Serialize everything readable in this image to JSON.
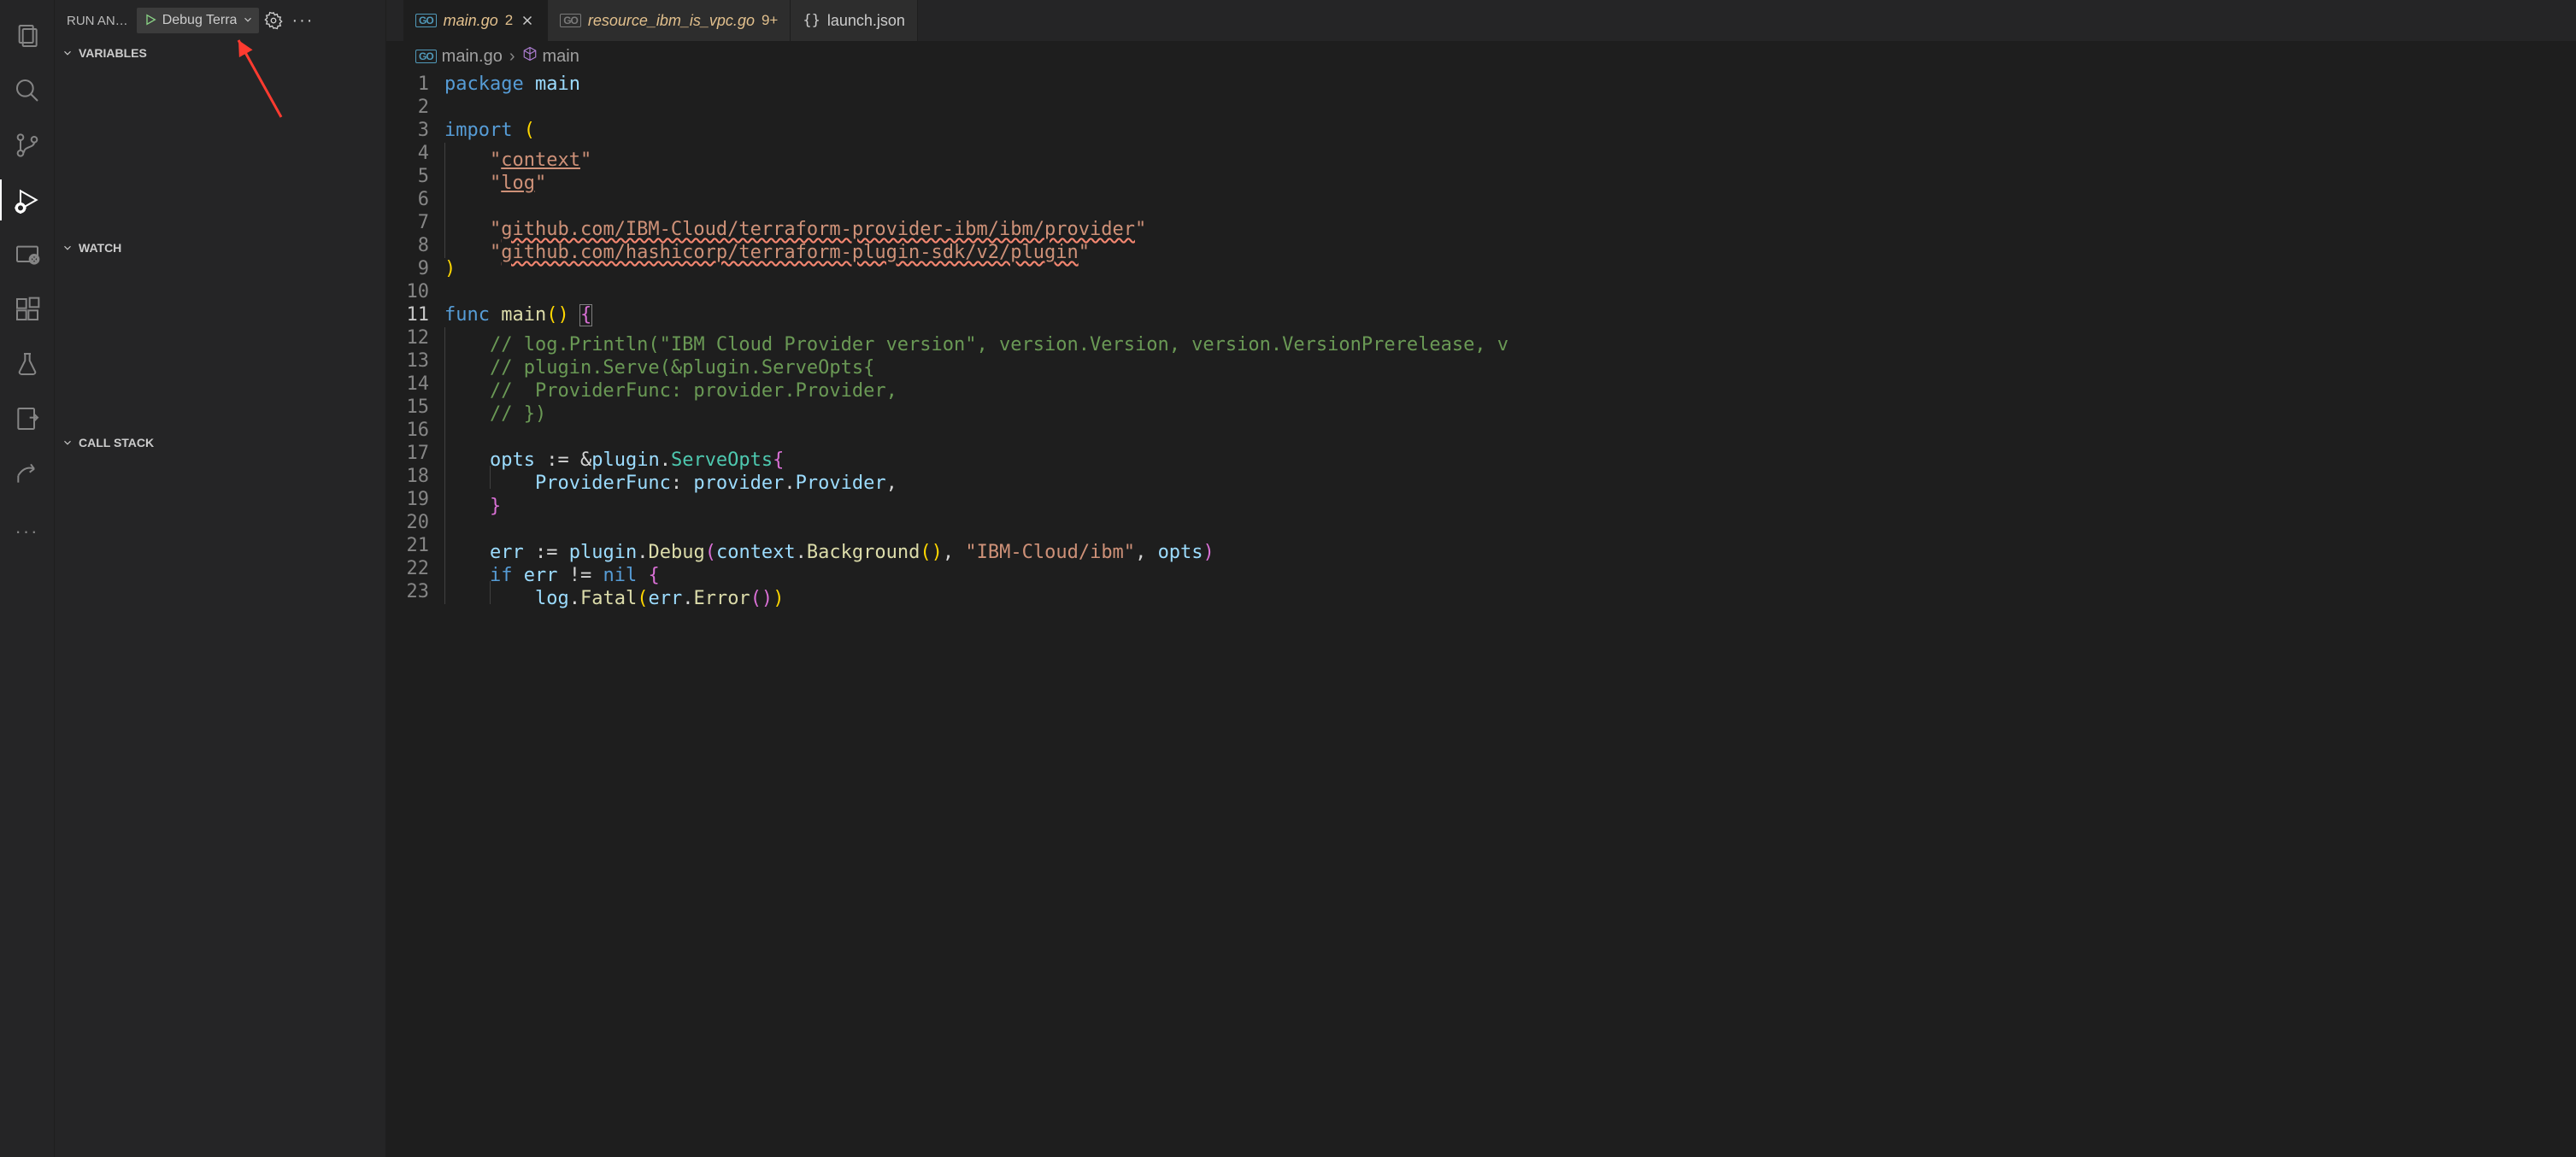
{
  "activity": {
    "items": [
      "explorer",
      "search",
      "source-control",
      "run-debug",
      "remote",
      "extensions",
      "testing",
      "references"
    ],
    "active": "run-debug"
  },
  "sidebar": {
    "title": "RUN AN…",
    "start_button": "▶",
    "config_name": "Debug Terra",
    "sections": {
      "variables": "VARIABLES",
      "watch": "WATCH",
      "callstack": "CALL STACK"
    }
  },
  "tabs": [
    {
      "icon": "go",
      "label": "main.go",
      "problems": "2",
      "active": true,
      "close": true,
      "modified": true
    },
    {
      "icon": "go",
      "label": "resource_ibm_is_vpc.go",
      "problems": "9+",
      "active": false,
      "close": false,
      "modified": true
    },
    {
      "icon": "json",
      "label": "launch.json",
      "problems": "",
      "active": false,
      "close": false,
      "modified": false
    }
  ],
  "breadcrumb": {
    "file_icon": "go",
    "file": "main.go",
    "symbol_icon": "module",
    "symbol": "main"
  },
  "code": {
    "lines": [
      {
        "n": 1,
        "tokens": [
          [
            "kw",
            "package "
          ],
          [
            "pkg",
            "main"
          ]
        ]
      },
      {
        "n": 2,
        "tokens": []
      },
      {
        "n": 3,
        "tokens": [
          [
            "kw",
            "import "
          ],
          [
            "paren",
            "("
          ]
        ]
      },
      {
        "n": 4,
        "tokens": [
          [
            "guide",
            ""
          ],
          [
            "plain",
            "    "
          ],
          [
            "str",
            "\""
          ],
          [
            "str-u",
            "context"
          ],
          [
            "str",
            "\""
          ]
        ]
      },
      {
        "n": 5,
        "tokens": [
          [
            "guide",
            ""
          ],
          [
            "plain",
            "    "
          ],
          [
            "str",
            "\""
          ],
          [
            "str-u",
            "log"
          ],
          [
            "str",
            "\""
          ]
        ]
      },
      {
        "n": 6,
        "tokens": [
          [
            "guide",
            ""
          ]
        ]
      },
      {
        "n": 7,
        "tokens": [
          [
            "guide",
            ""
          ],
          [
            "plain",
            "    "
          ],
          [
            "str",
            "\""
          ],
          [
            "str-err",
            "github.com/IBM-Cloud/terraform-provider-ibm/ibm/provider"
          ],
          [
            "str",
            "\""
          ]
        ]
      },
      {
        "n": 8,
        "tokens": [
          [
            "guide",
            ""
          ],
          [
            "plain",
            "    "
          ],
          [
            "str",
            "\""
          ],
          [
            "str-err",
            "github.com/hashicorp/terraform-plugin-sdk/v2/plugin"
          ],
          [
            "str",
            "\""
          ]
        ]
      },
      {
        "n": 9,
        "tokens": [
          [
            "paren",
            ")"
          ]
        ]
      },
      {
        "n": 10,
        "tokens": []
      },
      {
        "n": 11,
        "current": true,
        "tokens": [
          [
            "kw",
            "func "
          ],
          [
            "fn",
            "main"
          ],
          [
            "paren",
            "()"
          ],
          [
            "plain",
            " "
          ],
          [
            "cursor-brace",
            "{"
          ]
        ]
      },
      {
        "n": 12,
        "tokens": [
          [
            "guide",
            ""
          ],
          [
            "plain",
            "    "
          ],
          [
            "cmt",
            "// log.Println(\"IBM Cloud Provider version\", version.Version, version.VersionPrerelease, v"
          ]
        ]
      },
      {
        "n": 13,
        "tokens": [
          [
            "guide",
            ""
          ],
          [
            "plain",
            "    "
          ],
          [
            "cmt",
            "// plugin.Serve(&plugin.ServeOpts{"
          ]
        ]
      },
      {
        "n": 14,
        "tokens": [
          [
            "guide",
            ""
          ],
          [
            "plain",
            "    "
          ],
          [
            "cmt",
            "//  ProviderFunc: provider.Provider,"
          ]
        ]
      },
      {
        "n": 15,
        "tokens": [
          [
            "guide",
            ""
          ],
          [
            "plain",
            "    "
          ],
          [
            "cmt",
            "// })"
          ]
        ]
      },
      {
        "n": 16,
        "tokens": [
          [
            "guide",
            ""
          ]
        ]
      },
      {
        "n": 17,
        "tokens": [
          [
            "guide",
            ""
          ],
          [
            "plain",
            "    "
          ],
          [
            "id",
            "opts"
          ],
          [
            "plain",
            " "
          ],
          [
            "punct",
            ":="
          ],
          [
            "plain",
            " "
          ],
          [
            "punct",
            "&"
          ],
          [
            "id",
            "plugin"
          ],
          [
            "punct",
            "."
          ],
          [
            "type",
            "ServeOpts"
          ],
          [
            "brace",
            "{"
          ]
        ]
      },
      {
        "n": 18,
        "tokens": [
          [
            "guide",
            ""
          ],
          [
            "plain",
            "    "
          ],
          [
            "guide",
            ""
          ],
          [
            "plain",
            "    "
          ],
          [
            "id",
            "ProviderFunc"
          ],
          [
            "punct",
            ": "
          ],
          [
            "id",
            "provider"
          ],
          [
            "punct",
            "."
          ],
          [
            "id",
            "Provider"
          ],
          [
            "punct",
            ","
          ]
        ]
      },
      {
        "n": 19,
        "tokens": [
          [
            "guide",
            ""
          ],
          [
            "plain",
            "    "
          ],
          [
            "brace",
            "}"
          ]
        ]
      },
      {
        "n": 20,
        "tokens": [
          [
            "guide",
            ""
          ]
        ]
      },
      {
        "n": 21,
        "tokens": [
          [
            "guide",
            ""
          ],
          [
            "plain",
            "    "
          ],
          [
            "id",
            "err"
          ],
          [
            "plain",
            " "
          ],
          [
            "punct",
            ":="
          ],
          [
            "plain",
            " "
          ],
          [
            "id",
            "plugin"
          ],
          [
            "punct",
            "."
          ],
          [
            "fn",
            "Debug"
          ],
          [
            "brace",
            "("
          ],
          [
            "id",
            "context"
          ],
          [
            "punct",
            "."
          ],
          [
            "fn",
            "Background"
          ],
          [
            "paren",
            "()"
          ],
          [
            "punct",
            ", "
          ],
          [
            "str",
            "\"IBM-Cloud/ibm\""
          ],
          [
            "punct",
            ", "
          ],
          [
            "id",
            "opts"
          ],
          [
            "brace",
            ")"
          ]
        ]
      },
      {
        "n": 22,
        "tokens": [
          [
            "guide",
            ""
          ],
          [
            "plain",
            "    "
          ],
          [
            "kw",
            "if "
          ],
          [
            "id",
            "err"
          ],
          [
            "plain",
            " "
          ],
          [
            "punct",
            "!="
          ],
          [
            "plain",
            " "
          ],
          [
            "kw",
            "nil"
          ],
          [
            "plain",
            " "
          ],
          [
            "brace",
            "{"
          ]
        ]
      },
      {
        "n": 23,
        "tokens": [
          [
            "guide",
            ""
          ],
          [
            "plain",
            "    "
          ],
          [
            "guide",
            ""
          ],
          [
            "plain",
            "    "
          ],
          [
            "id",
            "log"
          ],
          [
            "punct",
            "."
          ],
          [
            "fn",
            "Fatal"
          ],
          [
            "paren",
            "("
          ],
          [
            "id",
            "err"
          ],
          [
            "punct",
            "."
          ],
          [
            "fn",
            "Error"
          ],
          [
            "brace",
            "()"
          ],
          [
            "paren",
            ")"
          ]
        ]
      }
    ]
  }
}
